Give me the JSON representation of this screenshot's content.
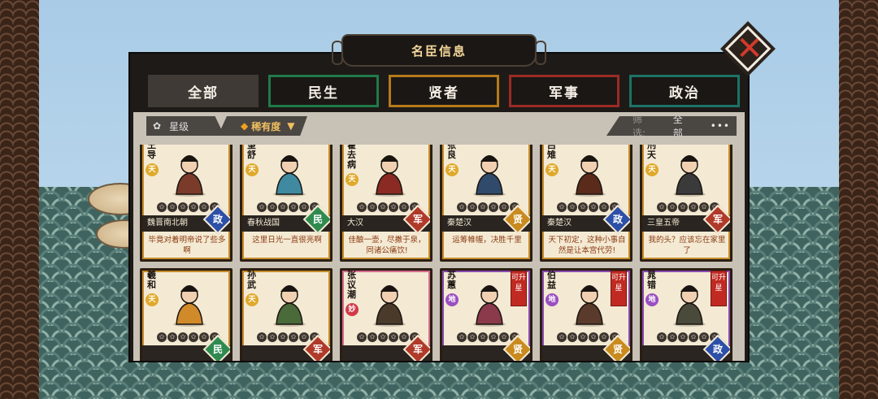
{
  "title": "名臣信息",
  "tabs": [
    {
      "label": "全部"
    },
    {
      "label": "民生"
    },
    {
      "label": "贤者"
    },
    {
      "label": "军事"
    },
    {
      "label": "政治"
    }
  ],
  "filters": {
    "star_label": "星级",
    "rarity_label": "稀有度",
    "screen_label": "筛选:",
    "screen_value": "全部",
    "more": "•••"
  },
  "cards": [
    {
      "name": "王导",
      "tier": "天",
      "dynasty": "魏晋南北朝",
      "category": "政",
      "quote": "毕竟对着明帝说了些多啊",
      "stars": 0
    },
    {
      "name": "望舒",
      "tier": "天",
      "dynasty": "春秋战国",
      "category": "民",
      "quote": "这里日光一直很亮啊",
      "stars": 0
    },
    {
      "name": "霍去病",
      "tier": "天",
      "dynasty": "大汉",
      "category": "军",
      "quote": "佳酿一壶，尽撒于泉，同诸公痛饮!",
      "stars": 0
    },
    {
      "name": "张良",
      "tier": "天",
      "dynasty": "秦楚汉",
      "category": "贤",
      "quote": "运筹帷幄，决胜千里",
      "stars": 0
    },
    {
      "name": "吕雉",
      "tier": "天",
      "dynasty": "秦楚汉",
      "category": "政",
      "quote": "天下初定，这种小事自然是让本宫代劳!",
      "stars": 0
    },
    {
      "name": "刑天",
      "tier": "天",
      "dynasty": "三皇五帝",
      "category": "军",
      "quote": "我的头？应该忘在家里了",
      "stars": 0
    },
    {
      "name": "羲和",
      "tier": "天",
      "dynasty": "",
      "category": "民",
      "quote": "",
      "stars": 0
    },
    {
      "name": "孙武",
      "tier": "天",
      "dynasty": "",
      "category": "军",
      "quote": "",
      "stars": 0
    },
    {
      "name": "张议潮",
      "tier": "妙",
      "dynasty": "",
      "category": "军",
      "quote": "",
      "stars": 0
    },
    {
      "name": "苏蕙",
      "tier": "地",
      "dynasty": "",
      "category": "贤",
      "quote": "",
      "stars": 0,
      "upgrade": "可升星"
    },
    {
      "name": "伯益",
      "tier": "地",
      "dynasty": "",
      "category": "贤",
      "quote": "",
      "stars": 0,
      "upgrade": "可升星"
    },
    {
      "name": "晁错",
      "tier": "地",
      "dynasty": "",
      "category": "政",
      "quote": "",
      "stars": 0,
      "upgrade": "可升星"
    }
  ]
}
